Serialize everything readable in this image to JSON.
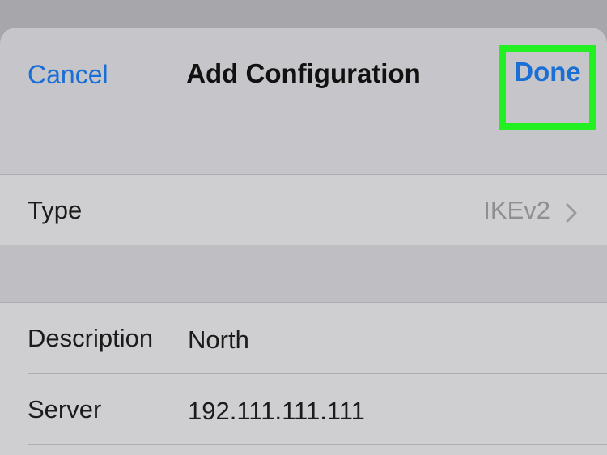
{
  "nav": {
    "cancel_label": "Cancel",
    "title": "Add Configuration",
    "done_label": "Done"
  },
  "type_row": {
    "label": "Type",
    "value": "IKEv2"
  },
  "fields": [
    {
      "label": "Description",
      "value": "North"
    },
    {
      "label": "Server",
      "value": "192.111.111.111"
    }
  ],
  "colors": {
    "accent": "#1a6fd6",
    "highlight": "#22f022",
    "background": "#a6a6ab"
  },
  "icons": {
    "type_row_chevron": "chevron-right-icon"
  }
}
